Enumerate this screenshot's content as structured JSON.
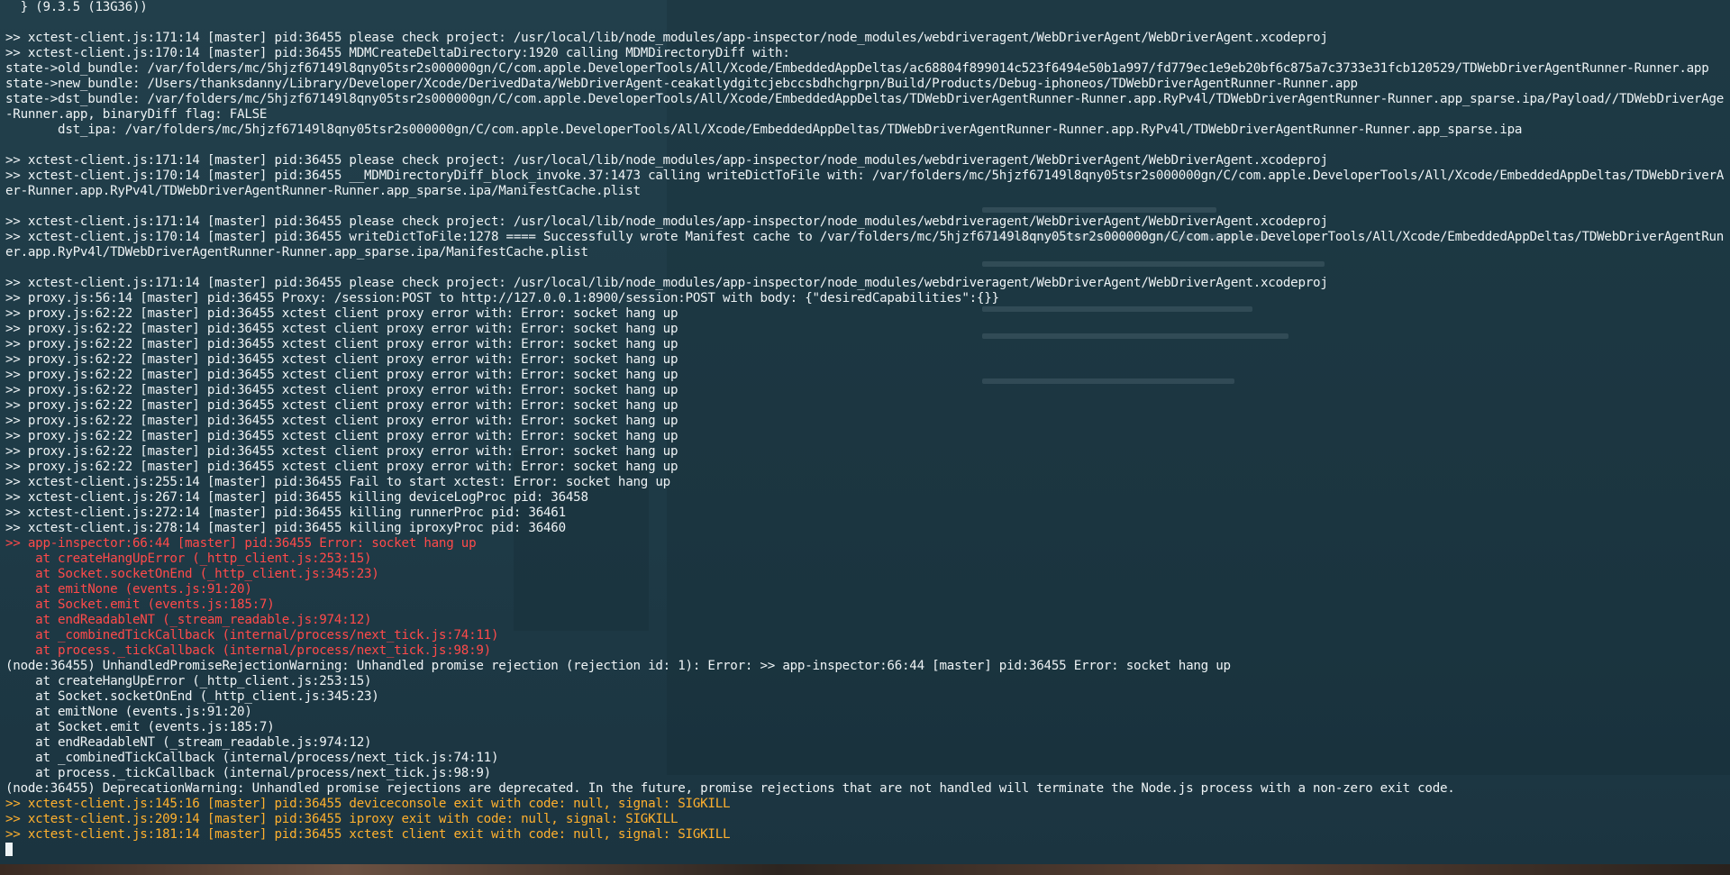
{
  "terminal": {
    "lines": [
      {
        "text": "  } (9.3.5 (13G36))",
        "style": "normal"
      },
      {
        "text": "",
        "style": "blank"
      },
      {
        "text": ">> xctest-client.js:171:14 [master] pid:36455 please check project: /usr/local/lib/node_modules/app-inspector/node_modules/webdriveragent/WebDriverAgent/WebDriverAgent.xcodeproj",
        "style": "normal"
      },
      {
        "text": ">> xctest-client.js:170:14 [master] pid:36455 MDMCreateDeltaDirectory:1920 calling MDMDirectoryDiff with:",
        "style": "normal"
      },
      {
        "text": "state->old_bundle: /var/folders/mc/5hjzf67149l8qny05tsr2s000000gn/C/com.apple.DeveloperTools/All/Xcode/EmbeddedAppDeltas/ac68804f899014c523f6494e50b1a997/fd779ec1e9eb20bf6c875a7c3733e31fcb120529/TDWebDriverAgentRunner-Runner.app",
        "style": "normal"
      },
      {
        "text": "state->new_bundle: /Users/thanksdanny/Library/Developer/Xcode/DerivedData/WebDriverAgent-ceakatlydgitcjebccsbdhchgrpn/Build/Products/Debug-iphoneos/TDWebDriverAgentRunner-Runner.app",
        "style": "normal"
      },
      {
        "text": "state->dst_bundle: /var/folders/mc/5hjzf67149l8qny05tsr2s000000gn/C/com.apple.DeveloperTools/All/Xcode/EmbeddedAppDeltas/TDWebDriverAgentRunner-Runner.app.RyPv4l/TDWebDriverAgentRunner-Runner.app_sparse.ipa/Payload//TDWebDriverAgentRunner",
        "style": "normal"
      },
      {
        "text": "-Runner.app, binaryDiff flag: FALSE",
        "style": "normal"
      },
      {
        "text": "       dst_ipa: /var/folders/mc/5hjzf67149l8qny05tsr2s000000gn/C/com.apple.DeveloperTools/All/Xcode/EmbeddedAppDeltas/TDWebDriverAgentRunner-Runner.app.RyPv4l/TDWebDriverAgentRunner-Runner.app_sparse.ipa",
        "style": "normal"
      },
      {
        "text": "",
        "style": "blank"
      },
      {
        "text": ">> xctest-client.js:171:14 [master] pid:36455 please check project: /usr/local/lib/node_modules/app-inspector/node_modules/webdriveragent/WebDriverAgent/WebDriverAgent.xcodeproj",
        "style": "normal"
      },
      {
        "text": ">> xctest-client.js:170:14 [master] pid:36455 __MDMDirectoryDiff_block_invoke.37:1473 calling writeDictToFile with: /var/folders/mc/5hjzf67149l8qny05tsr2s000000gn/C/com.apple.DeveloperTools/All/Xcode/EmbeddedAppDeltas/TDWebDriverAgentRunn",
        "style": "normal"
      },
      {
        "text": "er-Runner.app.RyPv4l/TDWebDriverAgentRunner-Runner.app_sparse.ipa/ManifestCache.plist",
        "style": "normal"
      },
      {
        "text": "",
        "style": "blank"
      },
      {
        "text": ">> xctest-client.js:171:14 [master] pid:36455 please check project: /usr/local/lib/node_modules/app-inspector/node_modules/webdriveragent/WebDriverAgent/WebDriverAgent.xcodeproj",
        "style": "normal"
      },
      {
        "text": ">> xctest-client.js:170:14 [master] pid:36455 writeDictToFile:1278 ==== Successfully wrote Manifest cache to /var/folders/mc/5hjzf67149l8qny05tsr2s000000gn/C/com.apple.DeveloperTools/All/Xcode/EmbeddedAppDeltas/TDWebDriverAgentRunn",
        "style": "normal"
      },
      {
        "text": "er.app.RyPv4l/TDWebDriverAgentRunner-Runner.app_sparse.ipa/ManifestCache.plist",
        "style": "normal"
      },
      {
        "text": "",
        "style": "blank"
      },
      {
        "text": ">> xctest-client.js:171:14 [master] pid:36455 please check project: /usr/local/lib/node_modules/app-inspector/node_modules/webdriveragent/WebDriverAgent/WebDriverAgent.xcodeproj",
        "style": "normal"
      },
      {
        "text": ">> proxy.js:56:14 [master] pid:36455 Proxy: /session:POST to http://127.0.0.1:8900/session:POST with body: {\"desiredCapabilities\":{}}",
        "style": "normal"
      },
      {
        "text": ">> proxy.js:62:22 [master] pid:36455 xctest client proxy error with: Error: socket hang up",
        "style": "normal"
      },
      {
        "text": ">> proxy.js:62:22 [master] pid:36455 xctest client proxy error with: Error: socket hang up",
        "style": "normal"
      },
      {
        "text": ">> proxy.js:62:22 [master] pid:36455 xctest client proxy error with: Error: socket hang up",
        "style": "normal"
      },
      {
        "text": ">> proxy.js:62:22 [master] pid:36455 xctest client proxy error with: Error: socket hang up",
        "style": "normal"
      },
      {
        "text": ">> proxy.js:62:22 [master] pid:36455 xctest client proxy error with: Error: socket hang up",
        "style": "normal"
      },
      {
        "text": ">> proxy.js:62:22 [master] pid:36455 xctest client proxy error with: Error: socket hang up",
        "style": "normal"
      },
      {
        "text": ">> proxy.js:62:22 [master] pid:36455 xctest client proxy error with: Error: socket hang up",
        "style": "normal"
      },
      {
        "text": ">> proxy.js:62:22 [master] pid:36455 xctest client proxy error with: Error: socket hang up",
        "style": "normal"
      },
      {
        "text": ">> proxy.js:62:22 [master] pid:36455 xctest client proxy error with: Error: socket hang up",
        "style": "normal"
      },
      {
        "text": ">> proxy.js:62:22 [master] pid:36455 xctest client proxy error with: Error: socket hang up",
        "style": "normal"
      },
      {
        "text": ">> proxy.js:62:22 [master] pid:36455 xctest client proxy error with: Error: socket hang up",
        "style": "normal"
      },
      {
        "text": ">> xctest-client.js:255:14 [master] pid:36455 Fail to start xctest: Error: socket hang up",
        "style": "normal"
      },
      {
        "text": ">> xctest-client.js:267:14 [master] pid:36455 killing deviceLogProc pid: 36458",
        "style": "normal"
      },
      {
        "text": ">> xctest-client.js:272:14 [master] pid:36455 killing runnerProc pid: 36461",
        "style": "normal"
      },
      {
        "text": ">> xctest-client.js:278:14 [master] pid:36455 killing iproxyProc pid: 36460",
        "style": "normal"
      },
      {
        "text": ">> app-inspector:66:44 [master] pid:36455 Error: socket hang up",
        "style": "err"
      },
      {
        "text": "    at createHangUpError (_http_client.js:253:15)",
        "style": "err"
      },
      {
        "text": "    at Socket.socketOnEnd (_http_client.js:345:23)",
        "style": "err"
      },
      {
        "text": "    at emitNone (events.js:91:20)",
        "style": "err"
      },
      {
        "text": "    at Socket.emit (events.js:185:7)",
        "style": "err"
      },
      {
        "text": "    at endReadableNT (_stream_readable.js:974:12)",
        "style": "err"
      },
      {
        "text": "    at _combinedTickCallback (internal/process/next_tick.js:74:11)",
        "style": "err"
      },
      {
        "text": "    at process._tickCallback (internal/process/next_tick.js:98:9)",
        "style": "err"
      },
      {
        "text": "(node:36455) UnhandledPromiseRejectionWarning: Unhandled promise rejection (rejection id: 1): Error: >> app-inspector:66:44 [master] pid:36455 Error: socket hang up",
        "style": "normal"
      },
      {
        "text": "    at createHangUpError (_http_client.js:253:15)",
        "style": "normal"
      },
      {
        "text": "    at Socket.socketOnEnd (_http_client.js:345:23)",
        "style": "normal"
      },
      {
        "text": "    at emitNone (events.js:91:20)",
        "style": "normal"
      },
      {
        "text": "    at Socket.emit (events.js:185:7)",
        "style": "normal"
      },
      {
        "text": "    at endReadableNT (_stream_readable.js:974:12)",
        "style": "normal"
      },
      {
        "text": "    at _combinedTickCallback (internal/process/next_tick.js:74:11)",
        "style": "normal"
      },
      {
        "text": "    at process._tickCallback (internal/process/next_tick.js:98:9)",
        "style": "normal"
      },
      {
        "text": "(node:36455) DeprecationWarning: Unhandled promise rejections are deprecated. In the future, promise rejections that are not handled will terminate the Node.js process with a non-zero exit code.",
        "style": "normal"
      },
      {
        "text": ">> xctest-client.js:145:16 [master] pid:36455 deviceconsole exit with code: null, signal: SIGKILL",
        "style": "warn"
      },
      {
        "text": ">> xctest-client.js:209:14 [master] pid:36455 iproxy exit with code: null, signal: SIGKILL",
        "style": "warn"
      },
      {
        "text": ">> xctest-client.js:181:14 [master] pid:36455 xctest client exit with code: null, signal: SIGKILL",
        "style": "warn"
      }
    ],
    "colors": {
      "text": "#eef3f5",
      "error": "#ff4a4a",
      "warning": "#ffb02e",
      "background": "#1f3a45"
    }
  }
}
